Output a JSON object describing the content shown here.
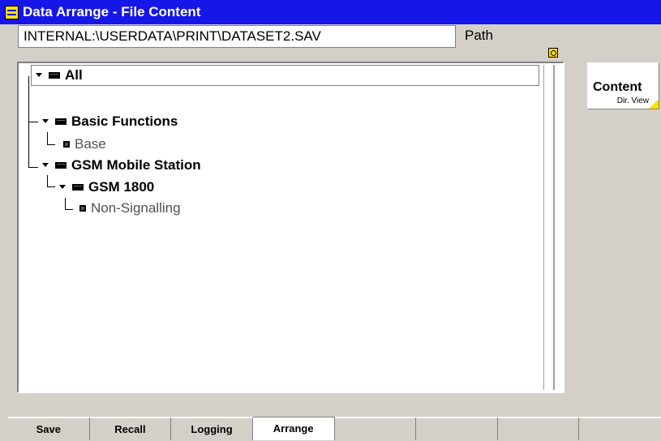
{
  "window": {
    "title": "Data Arrange - File Content"
  },
  "path": {
    "value": "INTERNAL:\\USERDATA\\PRINT\\DATASET2.SAV",
    "label": "Path"
  },
  "tree": {
    "items": [
      {
        "label": "All",
        "level": 0,
        "type": "folder",
        "expanded": true,
        "selected": true
      },
      {
        "label": "Basic Functions",
        "level": 1,
        "type": "folder",
        "expanded": true
      },
      {
        "label": "Base",
        "level": 2,
        "type": "leaf"
      },
      {
        "label": "GSM Mobile Station",
        "level": 1,
        "type": "folder",
        "expanded": true
      },
      {
        "label": "GSM 1800",
        "level": 2,
        "type": "folder",
        "expanded": true
      },
      {
        "label": "Non-Signalling",
        "level": 3,
        "type": "leaf"
      }
    ]
  },
  "side": {
    "content_label": "Content",
    "dir_view_label": "Dir. View"
  },
  "softkeys": [
    {
      "label": "Save"
    },
    {
      "label": "Recall"
    },
    {
      "label": "Logging"
    },
    {
      "label": "Arrange",
      "active": true
    },
    {
      "label": ""
    },
    {
      "label": ""
    },
    {
      "label": ""
    },
    {
      "label": ""
    }
  ],
  "colors": {
    "titlebar": "#1616e8",
    "accent": "#ffe000",
    "background": "#d4d0c8"
  }
}
